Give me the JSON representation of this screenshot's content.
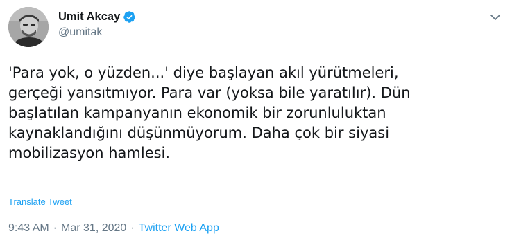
{
  "author": {
    "display_name": "Umit Akcay",
    "handle": "@umitak",
    "verified": true
  },
  "tweet": {
    "lines": [
      "'Para yok, o yüzden...' diye başlayan akıl yürütmeleri,",
      "gerçeği yansıtmıyor. Para var (yoksa bile yaratılır). Dün",
      "başlatılan kampanyanın ekonomik bir zorunluluktan",
      "kaynaklandığını düşünmüyorum. Daha çok bir siyasi",
      "mobilizasyon hamlesi."
    ],
    "translate_label": "Translate Tweet"
  },
  "meta": {
    "time": "9:43 AM",
    "separator": "·",
    "date": "Mar 31, 2020",
    "source": "Twitter Web App"
  },
  "icons": {
    "verified": "verified-badge-icon",
    "menu": "chevron-down-icon"
  },
  "colors": {
    "accent": "#1da1f2",
    "text": "#14171a",
    "secondary": "#657786"
  }
}
